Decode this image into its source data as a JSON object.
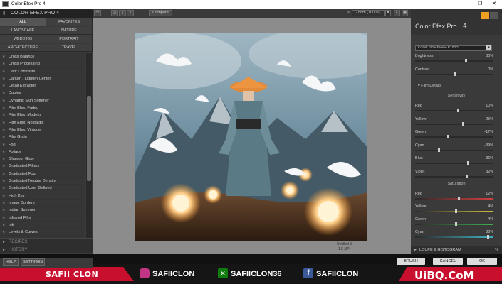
{
  "window": {
    "title": "Color Efex Pro 4",
    "controls": [
      "–",
      "❐",
      "✕"
    ]
  },
  "left_panel": {
    "logo": "COLOR EFEX PRO 4",
    "categories": [
      "ALL",
      "FAVORITES",
      "LANDSCAPE",
      "NATURE",
      "WEDDING",
      "PORTRAIT",
      "ARCHITECTURE",
      "TRAVEL"
    ],
    "filters": [
      "Cross Balance",
      "Cross Processing",
      "Dark Contrasts",
      "Darken / Lighten Center",
      "Detail Extractor",
      "Duplex",
      "Dynamic Skin Softener",
      "Film Efex: Faded",
      "Film Efex: Modern",
      "Film Efex: Nostalgic",
      "Film Efex: Vintage",
      "Film Grain",
      "Fog",
      "Foliage",
      "Glamour Glow",
      "Graduated Filters",
      "Graduated Fog",
      "Graduated Neutral Density",
      "Graduated User Defined",
      "High Key",
      "Image Borders",
      "Indian Summer",
      "Infrared Film",
      "Ink",
      "Levels & Curves"
    ],
    "recipes": "RECIPES",
    "history": "HISTORY",
    "help": "HELP",
    "settings": "SETTINGS"
  },
  "toolbar": {
    "compare": "Compare",
    "zoom": "Zoom (100 %)"
  },
  "canvas": {
    "filename": "Untitled-1",
    "filesize": "1.5 MP"
  },
  "right_panel": {
    "title": "Color Efex Pro",
    "title_num": "4",
    "preset": "Kodak Ektachrome E100G",
    "brightness": {
      "label": "Brightness",
      "value": "30%",
      "level": 0.65
    },
    "contrast": {
      "label": "Contrast",
      "value": "0%",
      "level": 0.5
    },
    "film_details": "Film Details",
    "sensitivity": {
      "title": "Sensitivity",
      "rows": [
        {
          "label": "Red",
          "value": "10%",
          "level": 0.55
        },
        {
          "label": "Yellow",
          "value": "25%",
          "level": 0.62
        },
        {
          "label": "Green",
          "value": "-17%",
          "level": 0.42
        },
        {
          "label": "Cyan",
          "value": "-39%",
          "level": 0.3
        },
        {
          "label": "Blue",
          "value": "36%",
          "level": 0.68
        },
        {
          "label": "Violet",
          "value": "32%",
          "level": 0.66
        }
      ]
    },
    "saturation": {
      "title": "Saturation",
      "rows": [
        {
          "label": "Red",
          "value": "12%",
          "level": 0.56,
          "color": "#d24040"
        },
        {
          "label": "Yellow",
          "value": "4%",
          "level": 0.52,
          "color": "#d2c040"
        },
        {
          "label": "Green",
          "value": "4%",
          "level": 0.52,
          "color": "#40b050"
        },
        {
          "label": "Cyan",
          "value": "88%",
          "level": 0.94,
          "color": "#40b0c0"
        }
      ]
    },
    "loupe": "LOUPE & HISTOGRAM",
    "loupe_pct": "%",
    "brush": "BRUSH",
    "cancel": "CANCEL",
    "ok": "OK"
  },
  "banner": {
    "name": "SAFII CLON",
    "social": [
      {
        "handle": "SAFIICLON",
        "icon": "instagram-icon",
        "color": "#c13584"
      },
      {
        "handle": "SAFIICLON36",
        "icon": "xbox-icon",
        "color": "#107c10"
      },
      {
        "handle": "SAFIICLON",
        "icon": "facebook-icon",
        "color": "#3b5998"
      }
    ],
    "accent": "#c8102e",
    "watermark": "UiBQ.CoM"
  }
}
